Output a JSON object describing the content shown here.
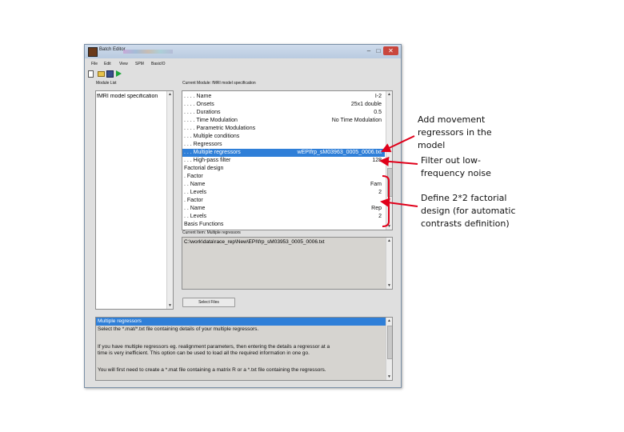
{
  "window": {
    "title": "Batch Editor",
    "min": "–",
    "max": "□",
    "close": "✕"
  },
  "menu": {
    "items": [
      "File",
      "Edit",
      "View",
      "SPM",
      "BasicIO"
    ]
  },
  "toolbar": {
    "icons": [
      "new-file-icon",
      "open-folder-icon",
      "save-icon",
      "run-icon"
    ]
  },
  "module_list": {
    "label": "Module List",
    "selected": "fMRI model specification"
  },
  "current_module": {
    "label": "Current Module: fMRI model specification",
    "rows": [
      {
        "name": ". . . . Name",
        "value": "I-2"
      },
      {
        "name": ". . . . Onsets",
        "value": "25x1 double"
      },
      {
        "name": ". . . . Durations",
        "value": "0.5"
      },
      {
        "name": ". . . . Time Modulation",
        "value": "No Time Modulation"
      },
      {
        "name": ". . . . Parametric Modulations",
        "value": ""
      },
      {
        "name": ". . . Multiple conditions",
        "value": ""
      },
      {
        "name": ". . . Regressors",
        "value": ""
      },
      {
        "name": ". . . Multiple regressors",
        "value": "wEPIfrp_sM03963_0005_0006.txt"
      },
      {
        "name": ". . . High-pass filter",
        "value": "128"
      },
      {
        "name": "Factorial design",
        "value": ""
      },
      {
        "name": ". Factor",
        "value": ""
      },
      {
        "name": ". . Name",
        "value": "Fam"
      },
      {
        "name": ". . Levels",
        "value": "2"
      },
      {
        "name": ". Factor",
        "value": ""
      },
      {
        "name": ". . Name",
        "value": "Rep"
      },
      {
        "name": ". . Levels",
        "value": "2"
      },
      {
        "name": "Basis Functions",
        "value": ""
      }
    ]
  },
  "current_item": {
    "label": "Current Item: Multiple regressors",
    "file": "C:\\work\\data\\race_rep\\New\\EPI\\frp_sM03953_0005_0006.txt",
    "button": "Select Files"
  },
  "help": {
    "title": "Multiple regressors",
    "lines": [
      "Select the *.mat/*.txt file containing details of your multiple regressors.",
      "",
      "If you have multiple regressors eg. realignment parameters, then entering the details a regressor at a",
      "time is very inefficient. This option can be used to load all the required information in one go.",
      "",
      "You will first need to create a *.mat file containing a matrix R or a *.txt file containing the regressors."
    ]
  },
  "annotations": {
    "movement": [
      "Add movement",
      "regressors in the",
      "model"
    ],
    "filter": [
      "Filter out low-",
      "frequency noise"
    ],
    "factorial": [
      "Define 2*2 factorial",
      "design (for automatic",
      "contrasts definition)"
    ],
    "arrow_color": "#e0001a"
  }
}
